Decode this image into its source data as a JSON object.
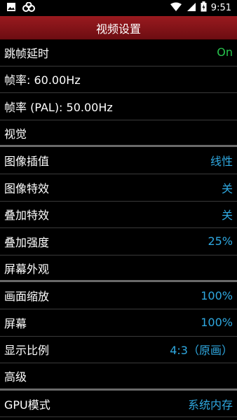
{
  "status_bar": {
    "time": "9:51",
    "icons": [
      "image-icon",
      "link-icon",
      "wifi-icon",
      "cell-signal-icon",
      "battery-icon"
    ]
  },
  "header": {
    "title": "视频设置"
  },
  "rows": [
    {
      "label": "跳帧延时",
      "value": "On",
      "value_type": "on",
      "section": false
    },
    {
      "label": "帧率: 60.00Hz",
      "value": "",
      "section": false
    },
    {
      "label": "帧率 (PAL): 50.00Hz",
      "value": "",
      "section": false
    },
    {
      "label": "视觉",
      "value": "",
      "section": true
    },
    {
      "label": "图像插值",
      "value": "线性",
      "section": false
    },
    {
      "label": "图像特效",
      "value": "关",
      "section": false
    },
    {
      "label": "叠加特效",
      "value": "关",
      "section": false
    },
    {
      "label": "叠加强度",
      "value": "25%",
      "section": false
    },
    {
      "label": "屏幕外观",
      "value": "",
      "section": true
    },
    {
      "label": "画面缩放",
      "value": "100%",
      "section": false
    },
    {
      "label": "屏幕",
      "value": "100%",
      "section": false
    },
    {
      "label": "显示比例",
      "value": "4:3（原画）",
      "section": false
    },
    {
      "label": "高级",
      "value": "",
      "section": true
    },
    {
      "label": "GPU模式",
      "value": "系统内存",
      "section": false
    }
  ],
  "colors": {
    "accent_value": "#2fa8e0",
    "on_value": "#27c24c",
    "title_bar": "#8a151a"
  }
}
